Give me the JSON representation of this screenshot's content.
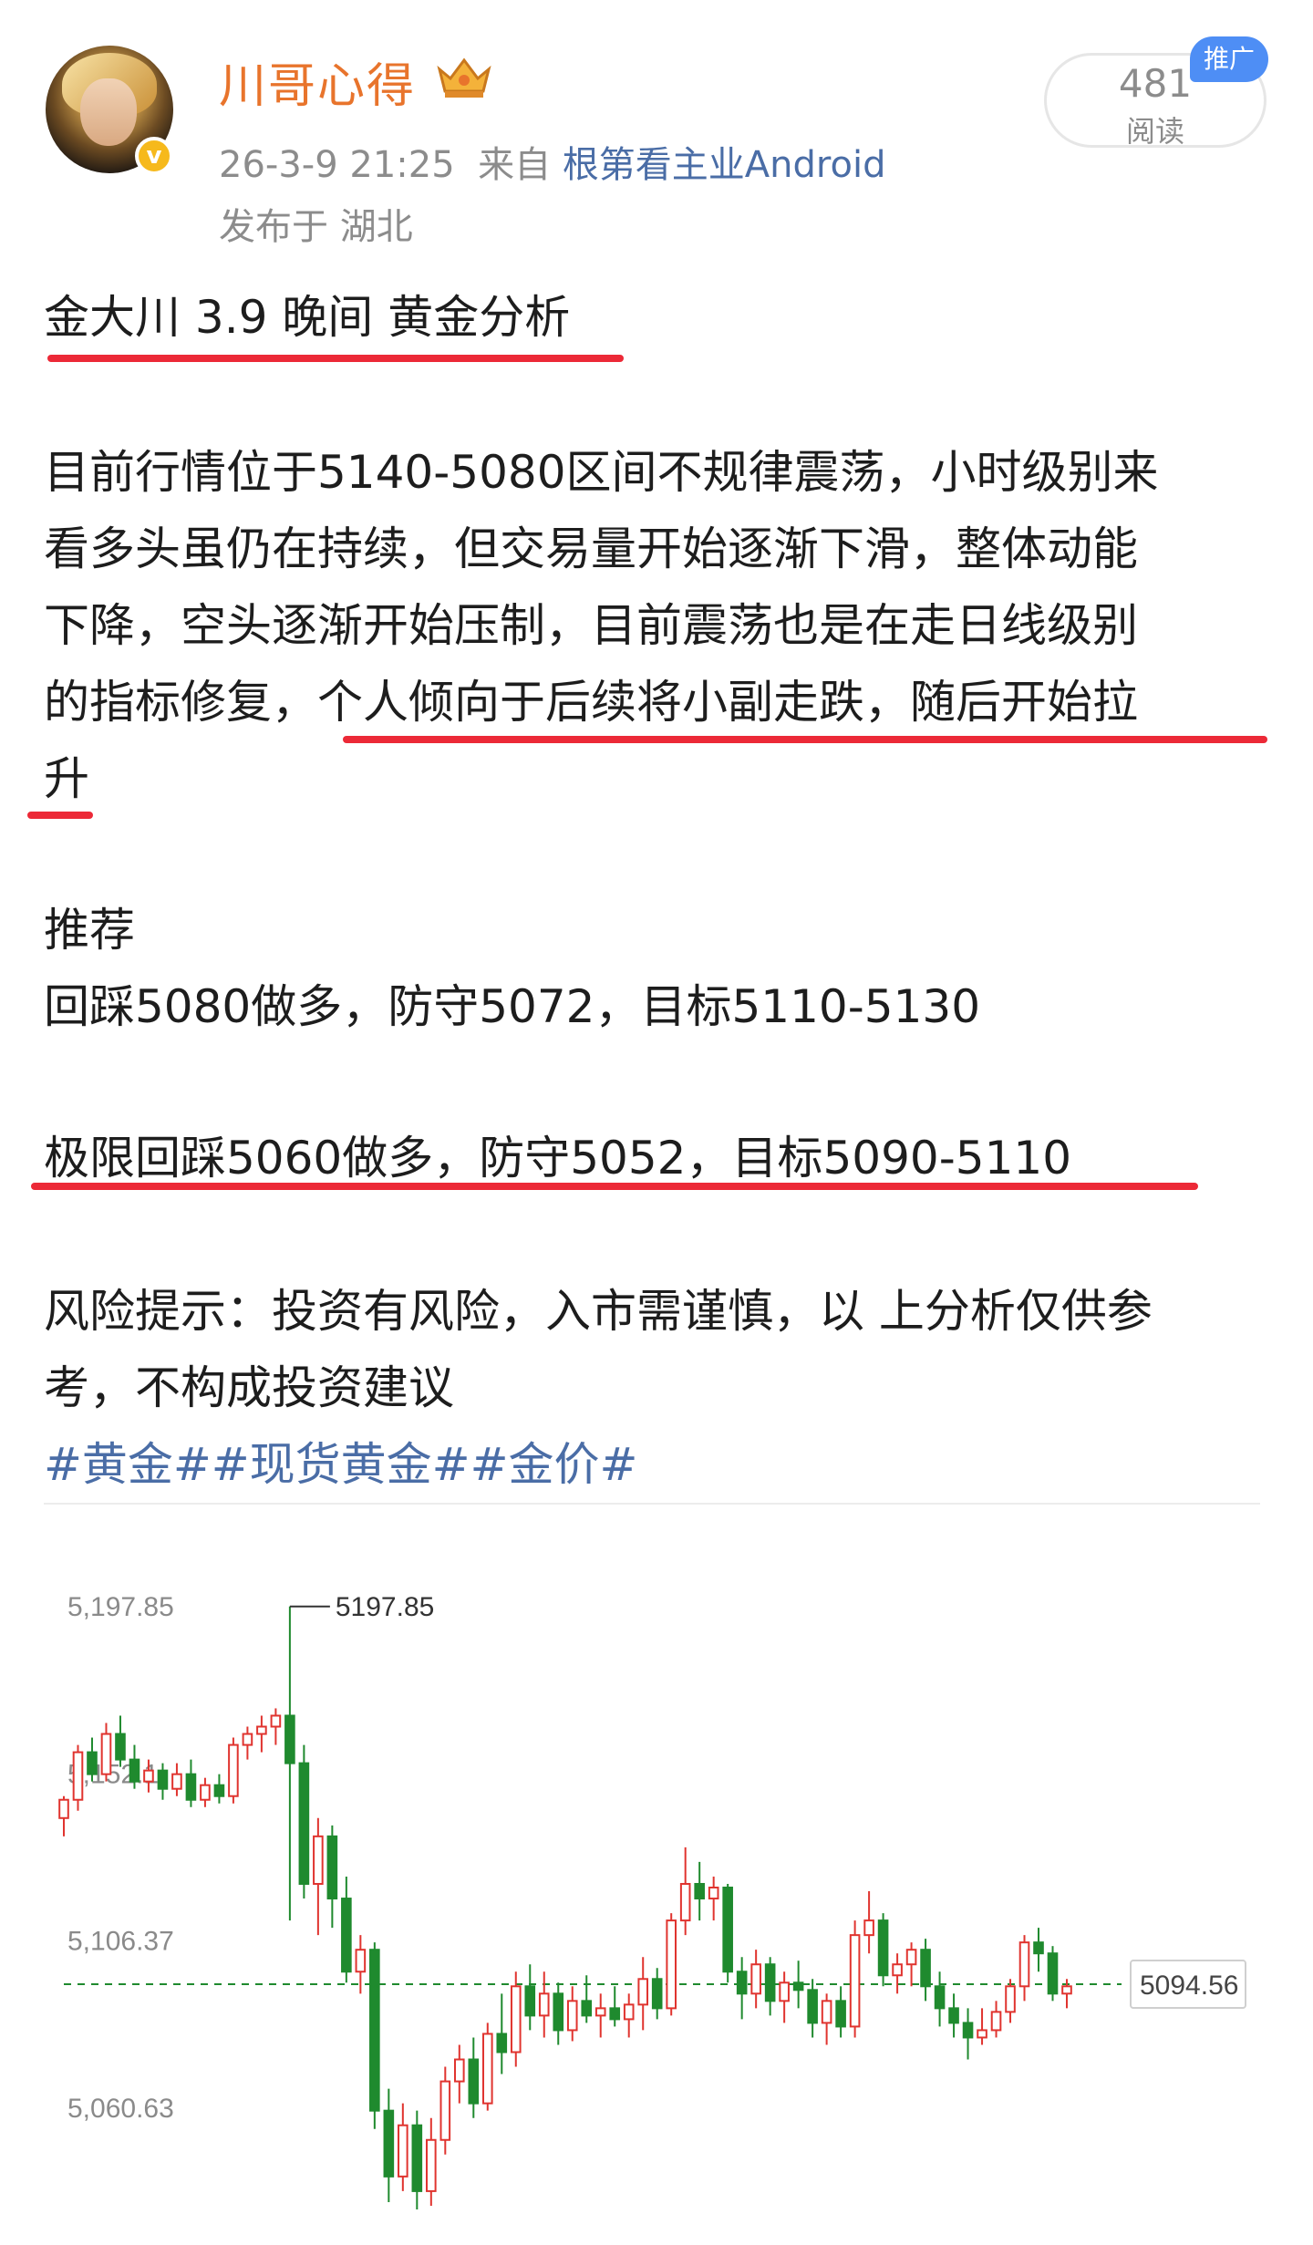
{
  "header": {
    "author_name": "川哥心得",
    "verified_mark": "v",
    "date": "26-3-9 21:25",
    "source_prefix": "来自",
    "source_app": "根第看主业Android",
    "location": "发布于 湖北",
    "reads_count": "481",
    "reads_label": "阅读",
    "promo_badge": "推广"
  },
  "post": {
    "title": "金大川 3.9 晚间 黄金分析",
    "body_lines": [
      "目前行情位于5140-5080区间不规律震荡，小时级别来",
      "看多头虽仍在持续，但交易量开始逐渐下滑，整体动能",
      "下降，空头逐渐开始压制，目前震荡也是在走日线级别"
    ],
    "body_line4_start": "的指标修复，",
    "body_line4_highlight": "个人倾向于后续将小副走跌，随后开始拉",
    "body_line5": "升",
    "recommend_heading": "推荐",
    "recommend_1": "回踩5080做多，防守5072，目标5110-5130",
    "recommend_2": "极限回踩5060做多，防守5052，目标5090-5110",
    "risk_line1": "风险提示：投资有风险，入市需谨慎，以 上分析仅供参",
    "risk_line2": "考，不构成投资建议",
    "tags": "#黄金##现货黄金##金价#"
  },
  "colors": {
    "author": "#e8742c",
    "link": "#4a6da6",
    "underline": "#ec2937",
    "bullish": "#e0342f",
    "bearish": "#1f8a2e",
    "current_line": "#1f8a2e"
  },
  "chart_data": {
    "type": "candlestick",
    "y_ticks": [
      "5,197.85",
      "5,152.1",
      "5,106.37",
      "5,060.63"
    ],
    "y_tick_values": [
      5197.85,
      5152.1,
      5106.37,
      5060.63
    ],
    "ylim": [
      5030,
      5212
    ],
    "high_annotation": "5197.85",
    "current_price_label": "5094.56",
    "current_price": 5094.56,
    "candles": [
      {
        "o": 5140,
        "h": 5146,
        "l": 5135,
        "c": 5145
      },
      {
        "o": 5145,
        "h": 5160,
        "l": 5142,
        "c": 5158
      },
      {
        "o": 5158,
        "h": 5162,
        "l": 5150,
        "c": 5152
      },
      {
        "o": 5152,
        "h": 5166,
        "l": 5150,
        "c": 5163
      },
      {
        "o": 5163,
        "h": 5168,
        "l": 5154,
        "c": 5156
      },
      {
        "o": 5156,
        "h": 5160,
        "l": 5148,
        "c": 5150
      },
      {
        "o": 5150,
        "h": 5156,
        "l": 5147,
        "c": 5153
      },
      {
        "o": 5153,
        "h": 5155,
        "l": 5145,
        "c": 5148
      },
      {
        "o": 5148,
        "h": 5155,
        "l": 5146,
        "c": 5152
      },
      {
        "o": 5152,
        "h": 5156,
        "l": 5143,
        "c": 5145
      },
      {
        "o": 5145,
        "h": 5151,
        "l": 5143,
        "c": 5149
      },
      {
        "o": 5149,
        "h": 5152,
        "l": 5144,
        "c": 5146
      },
      {
        "o": 5146,
        "h": 5162,
        "l": 5144,
        "c": 5160
      },
      {
        "o": 5160,
        "h": 5165,
        "l": 5156,
        "c": 5163
      },
      {
        "o": 5163,
        "h": 5168,
        "l": 5158,
        "c": 5165
      },
      {
        "o": 5165,
        "h": 5170,
        "l": 5160,
        "c": 5168
      },
      {
        "o": 5168,
        "h": 5197.85,
        "l": 5112,
        "c": 5155
      },
      {
        "o": 5155,
        "h": 5160,
        "l": 5118,
        "c": 5122
      },
      {
        "o": 5122,
        "h": 5140,
        "l": 5108,
        "c": 5135
      },
      {
        "o": 5135,
        "h": 5138,
        "l": 5110,
        "c": 5118
      },
      {
        "o": 5118,
        "h": 5124,
        "l": 5095,
        "c": 5098
      },
      {
        "o": 5098,
        "h": 5108,
        "l": 5092,
        "c": 5104
      },
      {
        "o": 5104,
        "h": 5106,
        "l": 5055,
        "c": 5060
      },
      {
        "o": 5060,
        "h": 5066,
        "l": 5035,
        "c": 5042
      },
      {
        "o": 5042,
        "h": 5062,
        "l": 5038,
        "c": 5056
      },
      {
        "o": 5056,
        "h": 5060,
        "l": 5033,
        "c": 5038
      },
      {
        "o": 5038,
        "h": 5058,
        "l": 5034,
        "c": 5052
      },
      {
        "o": 5052,
        "h": 5072,
        "l": 5048,
        "c": 5068
      },
      {
        "o": 5068,
        "h": 5078,
        "l": 5062,
        "c": 5074
      },
      {
        "o": 5074,
        "h": 5080,
        "l": 5058,
        "c": 5062
      },
      {
        "o": 5062,
        "h": 5084,
        "l": 5060,
        "c": 5081
      },
      {
        "o": 5081,
        "h": 5092,
        "l": 5070,
        "c": 5076
      },
      {
        "o": 5076,
        "h": 5098,
        "l": 5072,
        "c": 5094
      },
      {
        "o": 5094,
        "h": 5100,
        "l": 5082,
        "c": 5086
      },
      {
        "o": 5086,
        "h": 5098,
        "l": 5080,
        "c": 5092
      },
      {
        "o": 5092,
        "h": 5095,
        "l": 5078,
        "c": 5082
      },
      {
        "o": 5082,
        "h": 5094,
        "l": 5079,
        "c": 5090
      },
      {
        "o": 5090,
        "h": 5097,
        "l": 5084,
        "c": 5086
      },
      {
        "o": 5086,
        "h": 5092,
        "l": 5080,
        "c": 5088
      },
      {
        "o": 5088,
        "h": 5094,
        "l": 5083,
        "c": 5085
      },
      {
        "o": 5085,
        "h": 5092,
        "l": 5080,
        "c": 5089
      },
      {
        "o": 5089,
        "h": 5102,
        "l": 5082,
        "c": 5096
      },
      {
        "o": 5096,
        "h": 5099,
        "l": 5085,
        "c": 5088
      },
      {
        "o": 5088,
        "h": 5114,
        "l": 5086,
        "c": 5112
      },
      {
        "o": 5112,
        "h": 5132,
        "l": 5108,
        "c": 5122
      },
      {
        "o": 5122,
        "h": 5128,
        "l": 5112,
        "c": 5118
      },
      {
        "o": 5118,
        "h": 5124,
        "l": 5112,
        "c": 5121
      },
      {
        "o": 5121,
        "h": 5122,
        "l": 5095,
        "c": 5098
      },
      {
        "o": 5098,
        "h": 5102,
        "l": 5085,
        "c": 5092
      },
      {
        "o": 5092,
        "h": 5104,
        "l": 5088,
        "c": 5100
      },
      {
        "o": 5100,
        "h": 5102,
        "l": 5086,
        "c": 5090
      },
      {
        "o": 5090,
        "h": 5098,
        "l": 5084,
        "c": 5095
      },
      {
        "o": 5095,
        "h": 5101,
        "l": 5088,
        "c": 5093
      },
      {
        "o": 5093,
        "h": 5096,
        "l": 5080,
        "c": 5084
      },
      {
        "o": 5084,
        "h": 5092,
        "l": 5078,
        "c": 5090
      },
      {
        "o": 5090,
        "h": 5094,
        "l": 5080,
        "c": 5083
      },
      {
        "o": 5083,
        "h": 5112,
        "l": 5080,
        "c": 5108
      },
      {
        "o": 5108,
        "h": 5120,
        "l": 5103,
        "c": 5112
      },
      {
        "o": 5112,
        "h": 5114,
        "l": 5094,
        "c": 5097
      },
      {
        "o": 5097,
        "h": 5103,
        "l": 5092,
        "c": 5100
      },
      {
        "o": 5100,
        "h": 5106,
        "l": 5094,
        "c": 5104
      },
      {
        "o": 5104,
        "h": 5107,
        "l": 5090,
        "c": 5094
      },
      {
        "o": 5094,
        "h": 5098,
        "l": 5083,
        "c": 5088
      },
      {
        "o": 5088,
        "h": 5092,
        "l": 5080,
        "c": 5084
      },
      {
        "o": 5084,
        "h": 5088,
        "l": 5074,
        "c": 5080
      },
      {
        "o": 5080,
        "h": 5088,
        "l": 5078,
        "c": 5082
      },
      {
        "o": 5082,
        "h": 5090,
        "l": 5080,
        "c": 5087
      },
      {
        "o": 5087,
        "h": 5096,
        "l": 5084,
        "c": 5094
      },
      {
        "o": 5094,
        "h": 5108,
        "l": 5090,
        "c": 5106
      },
      {
        "o": 5106,
        "h": 5110,
        "l": 5098,
        "c": 5103
      },
      {
        "o": 5103,
        "h": 5105,
        "l": 5090,
        "c": 5092
      },
      {
        "o": 5092,
        "h": 5096,
        "l": 5088,
        "c": 5094
      }
    ]
  }
}
